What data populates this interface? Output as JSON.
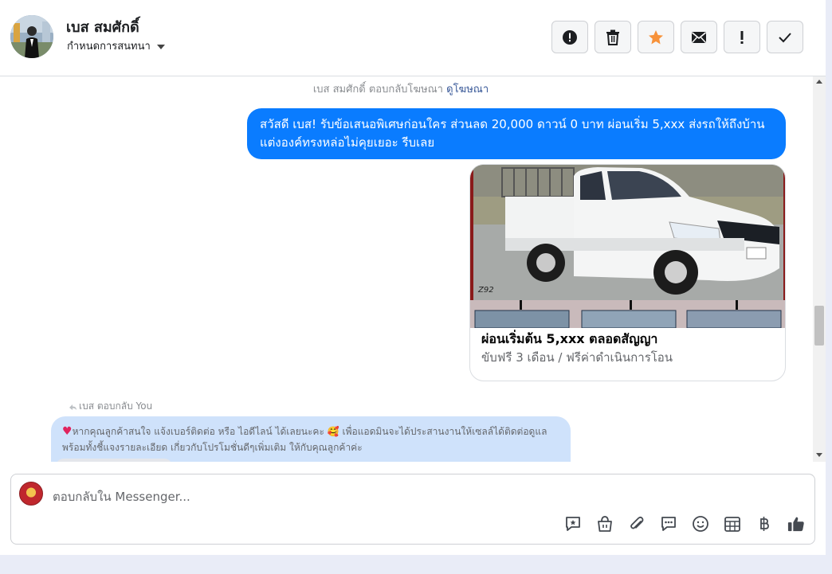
{
  "header": {
    "name": "เบส สมศักดิ์",
    "assign_label": "กำหนดการสนทนา",
    "actions": [
      {
        "icon": "alert-circle-icon"
      },
      {
        "icon": "trash-icon"
      },
      {
        "icon": "star-icon",
        "color": "#f7923a"
      },
      {
        "icon": "envelope-icon"
      },
      {
        "icon": "exclamation-icon"
      },
      {
        "icon": "check-icon"
      }
    ]
  },
  "conversation": {
    "replied_note_prefix": "เบส สมศักดิ์ ตอบกลับโฆษณา",
    "replied_note_link": "ดูโฆษณา",
    "outgoing_message": "สวัสดี เบส! รับข้อเสนอพิเศษก่อนใคร ส่วนลด 20,000 ดาวน์ 0 บาท ผ่อนเริ่ม 5,xxx ส่งรถให้ถึงบ้าน แต่งองค์ทรงหล่อไม่คุยเยอะ รีบเลย",
    "outgoing_color": "#0a7cff",
    "card": {
      "title": "ผ่อนเริ่มต้น 5,xxx ตลอดสัญญา",
      "subtitle": "ขับฟรี 3 เดือน / ฟรีค่าดำเนินการโอน",
      "image_watermark": "Z92"
    },
    "reply_label": "เบส ตอบกลับ You",
    "incoming_message": "หากคุณลูกค้าสนใจ แจ้งเบอร์ติดต่อ หรือ ไอดีไลน์ ได้เลยนะคะ 🥰 เพื่อแอดมินจะได้ประสานงานให้เซลล์ได้ติดต่อดูแลพร้อมทั้งชี้แจงรายละเอียด เกี่ยวกับโปรโมชั่นดีๆเพิ่มเติม ให้กับคุณลูกค้าค่ะ",
    "incoming_color": "#cfe2fb"
  },
  "composer": {
    "placeholder": "ตอบกลับใน Messenger...",
    "tools": [
      "sticker-icon",
      "shopping-bag-icon",
      "paperclip-icon",
      "saved-reply-icon",
      "emoji-icon",
      "calendar-grid-icon",
      "baht-icon",
      "thumbs-up-icon"
    ]
  }
}
